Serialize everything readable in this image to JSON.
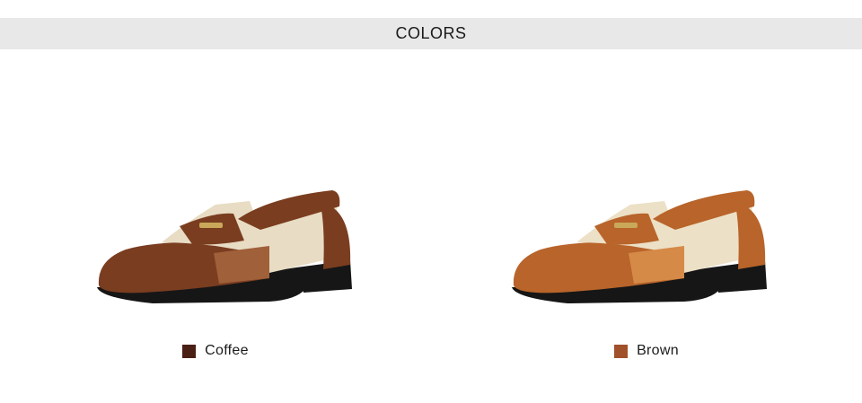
{
  "header": {
    "title": "COLORS"
  },
  "variants": [
    {
      "label": "Coffee",
      "swatch_color": "#4a1f14",
      "leather_color": "#7a3d20",
      "leather_highlight": "#a0603a",
      "canvas_color": "#e8dcc4",
      "icon": "loafer-shoe-icon"
    },
    {
      "label": "Brown",
      "swatch_color": "#a0512a",
      "leather_color": "#b8642a",
      "leather_highlight": "#d68a48",
      "canvas_color": "#ece0c6",
      "icon": "loafer-shoe-icon"
    }
  ],
  "colors": {
    "header_bg": "#e8e8e8",
    "sole": "#161616"
  }
}
